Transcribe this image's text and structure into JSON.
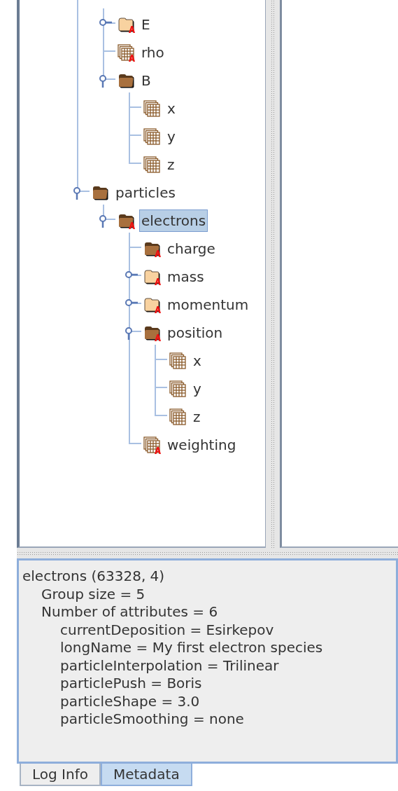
{
  "tree": {
    "items": [
      {
        "children": [
          {
            "label": "E",
            "kind": "group",
            "has_attributes": true,
            "expanded": false,
            "selected": false
          },
          {
            "label": "rho",
            "kind": "dataset",
            "has_attributes": true,
            "selected": false
          },
          {
            "label": "B",
            "kind": "group",
            "has_attributes": false,
            "expanded": true,
            "selected": false,
            "children": [
              {
                "label": "x",
                "kind": "dataset",
                "has_attributes": false,
                "selected": false
              },
              {
                "label": "y",
                "kind": "dataset",
                "has_attributes": false,
                "selected": false
              },
              {
                "label": "z",
                "kind": "dataset",
                "has_attributes": false,
                "selected": false
              }
            ]
          }
        ]
      },
      {
        "label": "particles",
        "kind": "group",
        "has_attributes": false,
        "expanded": true,
        "selected": false,
        "children": [
          {
            "label": "electrons",
            "kind": "group",
            "has_attributes": true,
            "expanded": true,
            "selected": true,
            "children": [
              {
                "label": "charge",
                "kind": "group",
                "has_attributes": true,
                "selected": false
              },
              {
                "label": "mass",
                "kind": "group",
                "has_attributes": true,
                "expanded": false,
                "selected": false
              },
              {
                "label": "momentum",
                "kind": "group",
                "has_attributes": true,
                "expanded": false,
                "selected": false
              },
              {
                "label": "position",
                "kind": "group",
                "has_attributes": true,
                "expanded": true,
                "selected": false,
                "children": [
                  {
                    "label": "x",
                    "kind": "dataset",
                    "has_attributes": false,
                    "selected": false
                  },
                  {
                    "label": "y",
                    "kind": "dataset",
                    "has_attributes": false,
                    "selected": false
                  },
                  {
                    "label": "z",
                    "kind": "dataset",
                    "has_attributes": false,
                    "selected": false
                  }
                ]
              },
              {
                "label": "weighting",
                "kind": "dataset",
                "has_attributes": true,
                "selected": false
              }
            ]
          }
        ]
      }
    ]
  },
  "metadata": {
    "lines": [
      {
        "text": "electrons (63328, 4)",
        "children": [
          {
            "text": "Group size = 5"
          },
          {
            "text": "Number of attributes = 6",
            "children": [
              {
                "text": "currentDeposition = Esirkepov"
              },
              {
                "text": "longName = My first electron species"
              },
              {
                "text": "particleInterpolation = Trilinear"
              },
              {
                "text": "particlePush = Boris"
              },
              {
                "text": "particleShape = 3.0"
              },
              {
                "text": "particleSmoothing = none"
              }
            ]
          }
        ]
      }
    ]
  },
  "tabs": [
    {
      "label": "Log Info",
      "selected": false
    },
    {
      "label": "Metadata",
      "selected": true
    }
  ]
}
